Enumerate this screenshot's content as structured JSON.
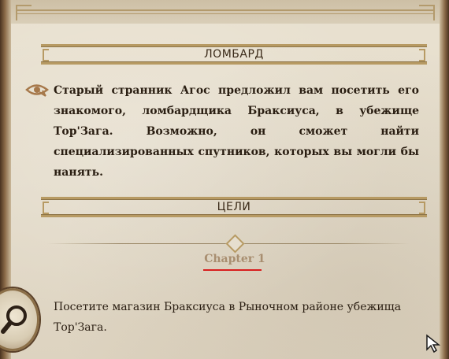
{
  "pawnshop_section": {
    "title": "ЛОМБАРД"
  },
  "quest_description": "Старый странник Агос предложил вам посетить его знакомого, ломбардщика Браксиуса, в убежище Тор'Зага. Возможно, он сможет найти специализированных спутников, которых вы могли бы нанять.",
  "goals_section": {
    "title": "ЦЕЛИ"
  },
  "chapter_label": "Chapter 1",
  "objective_text": "Посетите магазин Браксиуса в Рыночном районе убежища Тор'Зага.",
  "colors": {
    "accent_underline": "#d81e1e",
    "frame_gold": "#b79a63",
    "text_dark": "#2a1e12"
  },
  "icons": {
    "quest_marker": "eye-icon",
    "search": "magnifier-icon",
    "pointer": "cursor-icon"
  }
}
